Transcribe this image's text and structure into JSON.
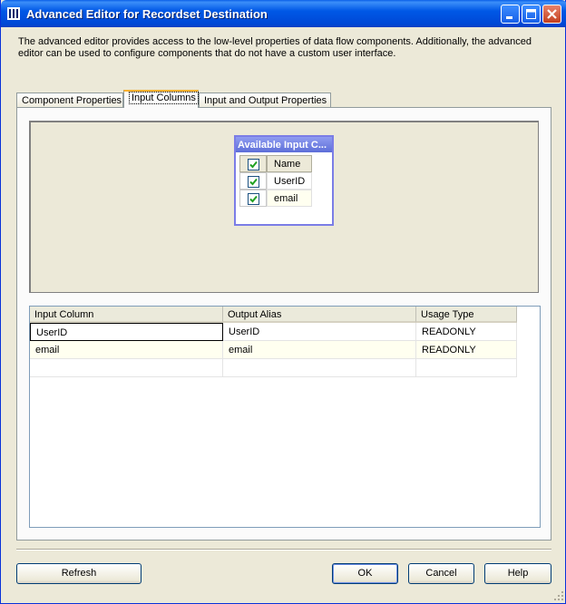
{
  "window": {
    "title": "Advanced Editor for Recordset Destination"
  },
  "description": "The advanced editor provides access to the low-level properties of data flow components. Additionally, the advanced editor can be used to configure components that do not have a custom user interface.",
  "tabs": [
    {
      "label": "Component Properties",
      "active": false
    },
    {
      "label": "Input Columns",
      "active": true
    },
    {
      "label": "Input and Output Properties",
      "active": false
    }
  ],
  "available_columns": {
    "title": "Available Input C...",
    "header_label": "Name",
    "header_checked": true,
    "rows": [
      {
        "name": "UserID",
        "checked": true
      },
      {
        "name": "email",
        "checked": true
      }
    ]
  },
  "mapping_grid": {
    "headers": [
      "Input Column",
      "Output Alias",
      "Usage Type"
    ],
    "rows": [
      {
        "input": "UserID",
        "alias": "UserID",
        "usage": "READONLY"
      },
      {
        "input": "email",
        "alias": "email",
        "usage": "READONLY"
      }
    ]
  },
  "buttons": {
    "refresh": "Refresh",
    "ok": "OK",
    "cancel": "Cancel",
    "help": "Help"
  },
  "colors": {
    "titlebar": "#0058e6",
    "window_bg": "#ece9d8",
    "active_tab_accent": "#f9b030",
    "available_title": "#5d6ed8"
  }
}
